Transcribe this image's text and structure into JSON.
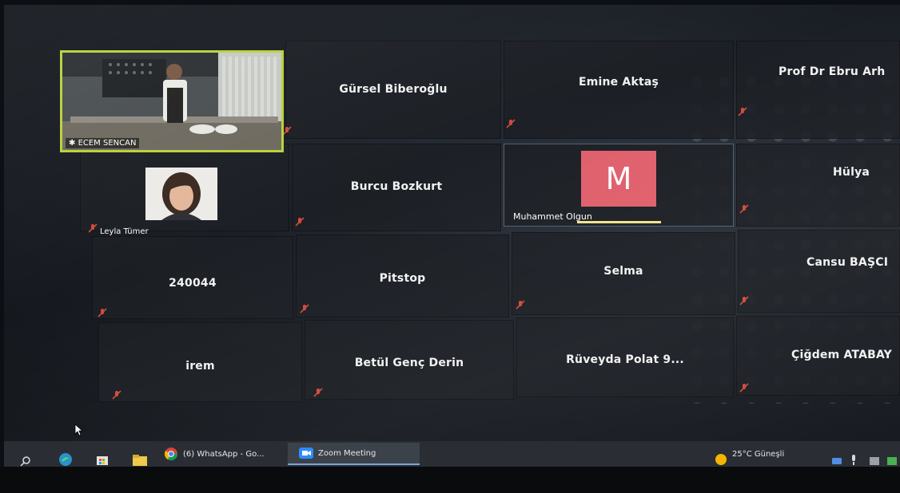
{
  "participants": [
    {
      "id": "gursel",
      "name": "Gürsel Biberoğlu"
    },
    {
      "id": "emine",
      "name": "Emine Aktaş"
    },
    {
      "id": "ebru",
      "name": "Prof Dr Ebru Arh"
    },
    {
      "id": "burcu",
      "name": "Burcu Bozkurt"
    },
    {
      "id": "hulya",
      "name": "Hülya"
    },
    {
      "id": "n240044",
      "name": "240044"
    },
    {
      "id": "pitstop",
      "name": "Pitstop"
    },
    {
      "id": "selma",
      "name": "Selma"
    },
    {
      "id": "cansu",
      "name": "Cansu BAŞCI"
    },
    {
      "id": "irem",
      "name": "irem"
    },
    {
      "id": "betul",
      "name": "Betül Genç Derin"
    },
    {
      "id": "ruveyda",
      "name": "Rüveyda Polat 9..."
    },
    {
      "id": "cigdem",
      "name": "Çiğdem ATABAY"
    }
  ],
  "video_participant": {
    "name": "ECEM SENCAN"
  },
  "photo_participant": {
    "name": "Leyla Tümer"
  },
  "active_speaker": {
    "name": "Muhammet Olgun",
    "initial": "M"
  },
  "taskbar": {
    "whatsapp_label": "(6) WhatsApp - Go...",
    "zoom_label": "Zoom Meeting",
    "weather": "25°C Güneşli"
  },
  "colors": {
    "active_speaker_border": "#b9d13b",
    "avatar_bg": "#e0606c",
    "mute_icon": "#c0392b"
  }
}
